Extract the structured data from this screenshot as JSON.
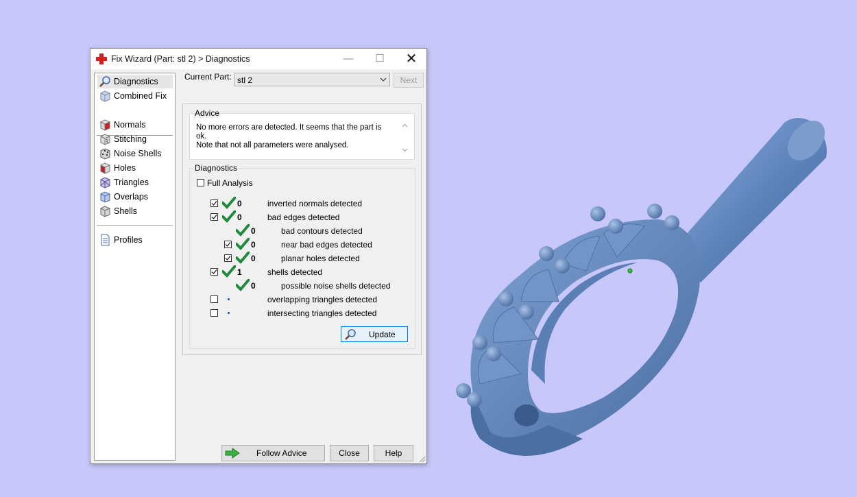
{
  "dialog": {
    "title": "Fix Wizard (Part: stl 2) > Diagnostics",
    "controls": {
      "minimize": "—",
      "maximize": "☐",
      "close": "✕"
    }
  },
  "nav": {
    "top_items": [
      {
        "label": "Diagnostics",
        "icon": "magnifier-icon",
        "selected": true
      },
      {
        "label": "Combined Fix",
        "icon": "cube-icon"
      }
    ],
    "fix_items": [
      {
        "label": "Normals",
        "icon": "cube-red-face-icon"
      },
      {
        "label": "Stitching",
        "icon": "cube-stitch-icon"
      },
      {
        "label": "Noise Shells",
        "icon": "cube-noise-icon"
      },
      {
        "label": "Holes",
        "icon": "cube-holes-icon"
      },
      {
        "label": "Triangles",
        "icon": "cube-triangles-icon"
      },
      {
        "label": "Overlaps",
        "icon": "cube-overlaps-icon"
      },
      {
        "label": "Shells",
        "icon": "cube-shells-icon"
      }
    ],
    "profiles": {
      "label": "Profiles",
      "icon": "document-icon"
    }
  },
  "part": {
    "label": "Current Part:",
    "value": "stl 2",
    "next_label": "Next"
  },
  "advice": {
    "title": "Advice",
    "line1": "No more errors are detected. It seems that the part is ok.",
    "line2": "Note that not all parameters were analysed."
  },
  "diagnostics": {
    "title": "Diagnostics",
    "full_analysis_label": "Full Analysis",
    "full_analysis_checked": false,
    "rows": [
      {
        "text": "inverted normals detected",
        "count": "0",
        "checkbox": true,
        "checked": true,
        "status": "ok",
        "indent": 0
      },
      {
        "text": "bad edges detected",
        "count": "0",
        "checkbox": true,
        "checked": true,
        "status": "ok",
        "indent": 0
      },
      {
        "text": "bad contours detected",
        "count": "0",
        "checkbox": false,
        "checked": false,
        "status": "ok",
        "indent": 1
      },
      {
        "text": "near bad edges detected",
        "count": "0",
        "checkbox": true,
        "checked": true,
        "status": "ok",
        "indent": 1
      },
      {
        "text": "planar holes detected",
        "count": "0",
        "checkbox": true,
        "checked": true,
        "status": "ok",
        "indent": 1
      },
      {
        "text": "shells detected",
        "count": "1",
        "checkbox": true,
        "checked": true,
        "status": "ok",
        "indent": 0
      },
      {
        "text": "possible noise shells detected",
        "count": "0",
        "checkbox": false,
        "checked": false,
        "status": "ok",
        "indent": 1
      },
      {
        "text": "overlapping triangles detected",
        "count": "",
        "checkbox": true,
        "checked": false,
        "status": "pending",
        "indent": 0
      },
      {
        "text": "intersecting triangles detected",
        "count": "",
        "checkbox": true,
        "checked": false,
        "status": "pending",
        "indent": 0
      }
    ],
    "update_label": "Update"
  },
  "footer": {
    "follow_advice_label": "Follow Advice",
    "close_label": "Close",
    "help_label": "Help"
  },
  "colors": {
    "background": "#c7c7fa",
    "model": "#6b8fc4",
    "check_green": "#1e8a3a"
  }
}
